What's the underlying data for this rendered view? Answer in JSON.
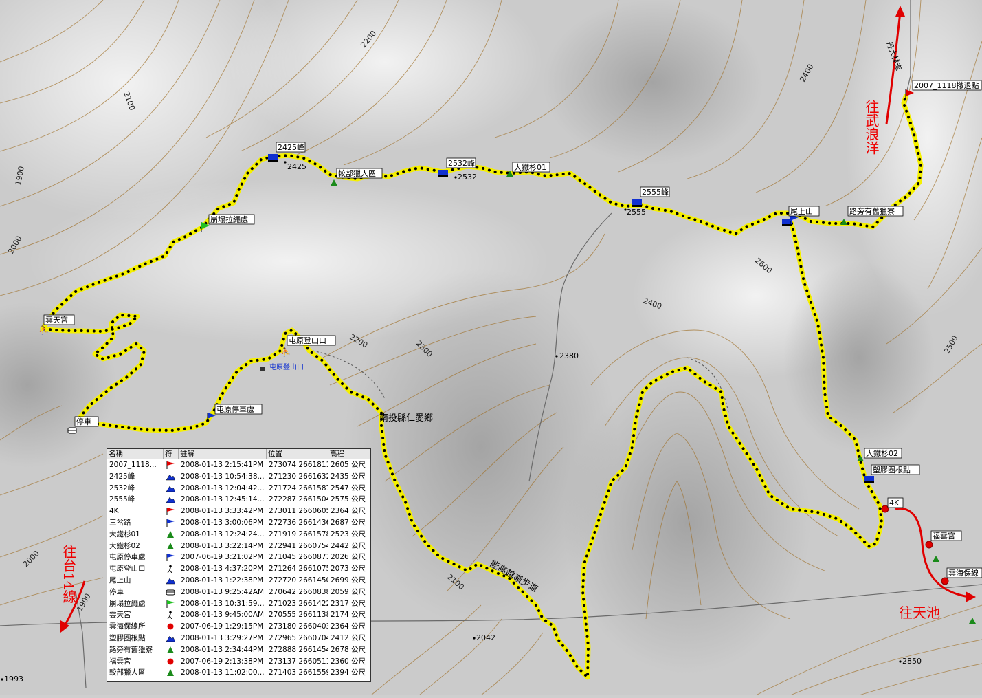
{
  "map": {
    "contour_labels": [
      "2100",
      "2200",
      "1900",
      "2000",
      "2400",
      "2200",
      "2300",
      "2400",
      "2600",
      "2500",
      "2000",
      "1900",
      "2100"
    ],
    "spot_heights": [
      "2425",
      "2532",
      "2555",
      "2380",
      "2042",
      "1993",
      "2850"
    ],
    "waypoint_labels": {
      "w2425": "2425峰",
      "w2532": "2532峰",
      "w2555": "2555峰",
      "datie01": "大鐵杉01",
      "jiaobu": "較部獵人區",
      "bengta": "崩塌拉繩處",
      "yuntian": "雲天宮",
      "tunyuan": "屯原登山口",
      "tunyuan_trail": "屯原登山口",
      "parking": "停車",
      "tunyuan_park": "屯原停車處",
      "weishang": "尾上山",
      "lupang": "路旁有舊獵寮",
      "waypoint_2007": "2007_1118撤退點",
      "datie02": "大鐵杉02",
      "sujiao": "塑膠圈根點",
      "k4": "4K",
      "fuyun": "福雲宮",
      "yunhai": "雲海保線",
      "nantou": "南投縣仁愛鄉",
      "nenggao": "能高越嶺步道",
      "road_label": "丹大林道"
    },
    "directions": {
      "wulangyang": "往武浪洋",
      "tianchi": "往天池",
      "tai14": "往台14線"
    },
    "colors": {
      "track": "#f5f000",
      "track_dot": "#000000",
      "arrow": "#e00000",
      "flag_red": "#e00000",
      "flag_blue": "#1030d0",
      "flag_green": "#20c020"
    }
  },
  "table": {
    "headers": [
      "名稱",
      "符",
      "註解",
      "位置",
      "高程"
    ],
    "rows": [
      {
        "name": "2007_1118...",
        "icon": "red-flag-icon",
        "note": "2008-01-13 2:15:41PM",
        "pos": "273074 2661811",
        "elev": "2605 公尺"
      },
      {
        "name": "2425峰",
        "icon": "summit-icon",
        "note": "2008-01-13 10:54:38...",
        "pos": "271230 2661632",
        "elev": "2435 公尺"
      },
      {
        "name": "2532峰",
        "icon": "summit-icon",
        "note": "2008-01-13 12:04:42...",
        "pos": "271724 2661587",
        "elev": "2547 公尺"
      },
      {
        "name": "2555峰",
        "icon": "summit-icon",
        "note": "2008-01-13 12:45:14...",
        "pos": "272287 2661504",
        "elev": "2575 公尺"
      },
      {
        "name": "4K",
        "icon": "red-flag-icon",
        "note": "2008-01-13 3:33:42PM",
        "pos": "273011 2660605",
        "elev": "2364 公尺"
      },
      {
        "name": "三岔路",
        "icon": "blue-flag-icon",
        "note": "2008-01-13 3:00:06PM",
        "pos": "272736 2661436",
        "elev": "2687 公尺"
      },
      {
        "name": "大鐵杉01",
        "icon": "tree-icon",
        "note": "2008-01-13 12:24:24...",
        "pos": "271919 2661578",
        "elev": "2523 公尺"
      },
      {
        "name": "大鐵杉02",
        "icon": "tree-icon",
        "note": "2008-01-13 3:22:14PM",
        "pos": "272941 2660754",
        "elev": "2442 公尺"
      },
      {
        "name": "屯原停車處",
        "icon": "blue-flag-icon",
        "note": "2007-06-19 3:21:02PM",
        "pos": "271045 2660871",
        "elev": "2026 公尺"
      },
      {
        "name": "屯原登山口",
        "icon": "hiker-icon",
        "note": "2008-01-13 4:37:20PM",
        "pos": "271264 2661075",
        "elev": "2073 公尺"
      },
      {
        "name": "尾上山",
        "icon": "summit-icon",
        "note": "2008-01-13 1:22:38PM",
        "pos": "272720 2661450",
        "elev": "2699 公尺"
      },
      {
        "name": "停車",
        "icon": "car-icon",
        "note": "2008-01-13 9:25:42AM",
        "pos": "270642 2660838",
        "elev": "2059 公尺"
      },
      {
        "name": "崩塌拉繩處",
        "icon": "green-flag-icon",
        "note": "2008-01-13 10:31:59...",
        "pos": "271023 2661422",
        "elev": "2317 公尺"
      },
      {
        "name": "雲天宮",
        "icon": "hiker-icon",
        "note": "2008-01-13 9:45:00AM",
        "pos": "270555 2661138",
        "elev": "2174 公尺"
      },
      {
        "name": "雲海保線所",
        "icon": "red-dot-icon",
        "note": "2007-06-19 1:29:15PM",
        "pos": "273180 2660403",
        "elev": "2364 公尺"
      },
      {
        "name": "塑膠圈根點",
        "icon": "summit-icon",
        "note": "2008-01-13 3:29:27PM",
        "pos": "272965 2660704",
        "elev": "2412 公尺"
      },
      {
        "name": "路旁有舊獵寮",
        "icon": "tree-icon",
        "note": "2008-01-13 2:34:44PM",
        "pos": "272888 2661454",
        "elev": "2678 公尺"
      },
      {
        "name": "福雲宮",
        "icon": "red-dot-icon",
        "note": "2007-06-19 2:13:38PM",
        "pos": "273137 2660511",
        "elev": "2360 公尺"
      },
      {
        "name": "較部獵人區",
        "icon": "tree-icon",
        "note": "2008-01-13 11:02:00...",
        "pos": "271403 2661559",
        "elev": "2394 公尺"
      }
    ]
  }
}
